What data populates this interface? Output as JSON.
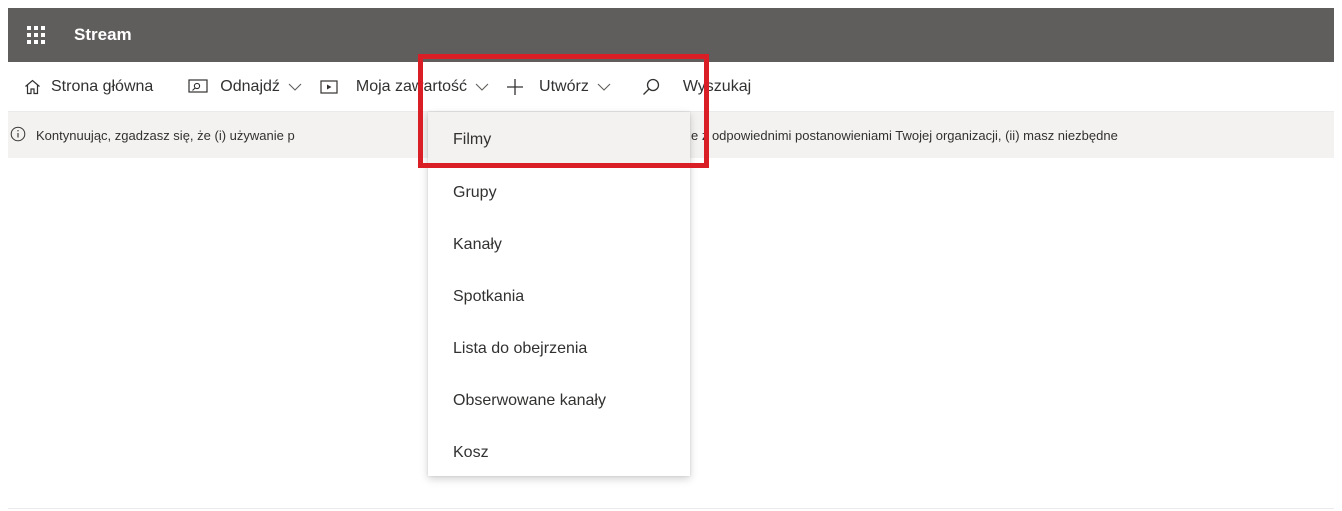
{
  "header": {
    "app_title": "Stream",
    "waffle_icon": "app-launcher-icon",
    "background_color": "#605e5c"
  },
  "nav": {
    "home": {
      "label": "Strona główna",
      "icon": "home-icon"
    },
    "discover": {
      "label": "Odnajdź",
      "icon": "discover-icon"
    },
    "my_content": {
      "label": "Moja zawartość",
      "icon": "video-icon"
    },
    "create": {
      "label": "Utwórz",
      "icon": "plus-icon"
    },
    "search": {
      "label": "Wyszukaj",
      "icon": "search-icon"
    }
  },
  "notice": {
    "icon": "info-icon",
    "text_left": "Kontynuując, zgadzasz się, że (i) używanie p",
    "text_right": "e z odpowiednimi postanowieniami Twojej organizacji, (ii) masz niezbędne"
  },
  "dropdown": {
    "items": [
      {
        "label": "Filmy",
        "selected": true
      },
      {
        "label": "Grupy"
      },
      {
        "label": "Kanały"
      },
      {
        "label": "Spotkania"
      },
      {
        "label": "Lista do obejrzenia"
      },
      {
        "label": "Obserwowane kanały"
      },
      {
        "label": "Kosz"
      }
    ]
  },
  "highlight_color": "#d91e26"
}
